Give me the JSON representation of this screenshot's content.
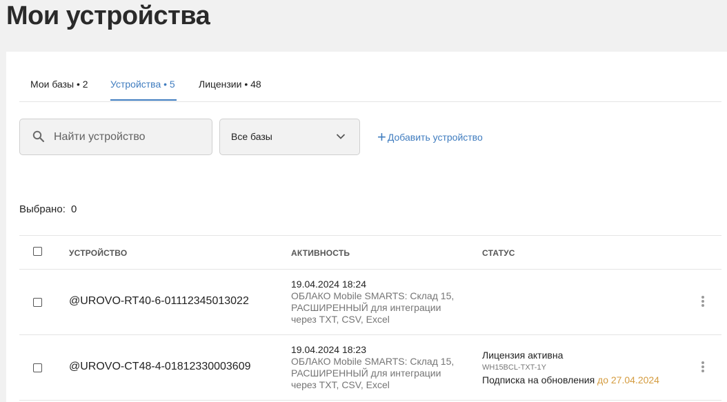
{
  "page": {
    "title": "Мои устройства"
  },
  "tabs": [
    {
      "label": "Мои базы • 2",
      "active": false
    },
    {
      "label": "Устройства • 5",
      "active": true
    },
    {
      "label": "Лицензии • 48",
      "active": false
    }
  ],
  "filters": {
    "search_placeholder": "Найти устройство",
    "search_value": "",
    "base_select": "Все базы",
    "add_device_label": "Добавить устройство"
  },
  "selection": {
    "label": "Выбрано:",
    "count": "0"
  },
  "table": {
    "columns": [
      "УСТРОЙСТВО",
      "АКТИВНОСТЬ",
      "СТАТУС"
    ],
    "rows": [
      {
        "device": "@UROVO-RT40-6-01112345013022",
        "activity_date": "19.04.2024 18:24",
        "activity_desc": "ОБЛАКО Mobile SMARTS: Склад 15, РАСШИРЕННЫЙ для интеграции через TXT, CSV, Excel",
        "status": "",
        "license_code": "",
        "subscription": "",
        "subscription_until": ""
      },
      {
        "device": "@UROVO-CT48-4-01812330003609",
        "activity_date": "19.04.2024 18:23",
        "activity_desc": "ОБЛАКО Mobile SMARTS: Склад 15, РАСШИРЕННЫЙ для интеграции через TXT, CSV, Excel",
        "status": "Лицензия активна",
        "license_code": "WH15BCL-TXT-1Y",
        "subscription": "Подписка на обновления",
        "subscription_until": "до 27.04.2024"
      }
    ]
  },
  "colors": {
    "accent": "#3f7cbf",
    "warning": "#d49b3e",
    "background": "#f1f1f1"
  },
  "icons": {
    "search": "search-icon",
    "dropdown": "chevron-down-icon",
    "add": "plus-icon",
    "menu": "more-vertical-icon"
  }
}
